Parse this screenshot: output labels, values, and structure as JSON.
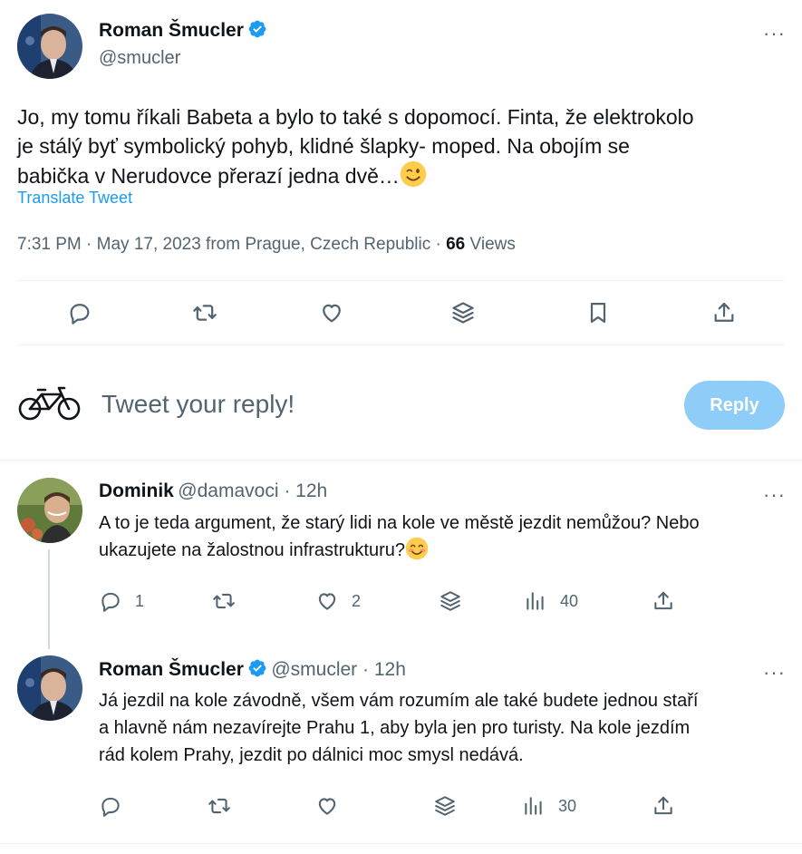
{
  "main_tweet": {
    "author_name": "Roman Šmucler",
    "author_handle": "@smucler",
    "text_line1": "Jo, my tomu říkali Babeta a bylo to také s dopomocí. Finta, že elektrokolo",
    "text_line2": "je stálý byť symbolický pohyb, klidné šlapky- moped. Na obojím se",
    "text_line3": "babička v Nerudovce přerazí jedna dvě…",
    "translate_label": "Translate Tweet",
    "timestamp": "7:31 PM · May 17, 2023 from Prague, Czech Republic · ",
    "views_count": "66",
    "views_label": " Views"
  },
  "composer": {
    "placeholder": "Tweet your reply!",
    "reply_button": "Reply"
  },
  "replies": [
    {
      "author_name": "Dominik",
      "author_handle": "@damavoci · 12h",
      "text_line1": "A to je teda argument, že starý lidi na kole ve městě jezdit nemůžou? Nebo",
      "text_line2": "ukazujete na žalostnou infrastrukturu?",
      "reply_count": "1",
      "like_count": "2",
      "view_count": "40"
    },
    {
      "author_name": "Roman Šmucler",
      "author_handle": "@smucler · 12h",
      "text_line1": "Já jezdil na kole závodně, všem vám rozumím ale také budete jednou staří",
      "text_line2": "a hlavně nám nezavírejte Prahu 1, aby byla jen pro turisty. Na kole jezdím",
      "text_line3": "rád kolem Prahy, jezdit po dálnici moc smysl nedává.",
      "view_count": "30"
    }
  ],
  "icons": {
    "verified_color": "#1d9bf0",
    "accent": "#1d9bf0",
    "muted": "#536471"
  },
  "more_label": "···"
}
